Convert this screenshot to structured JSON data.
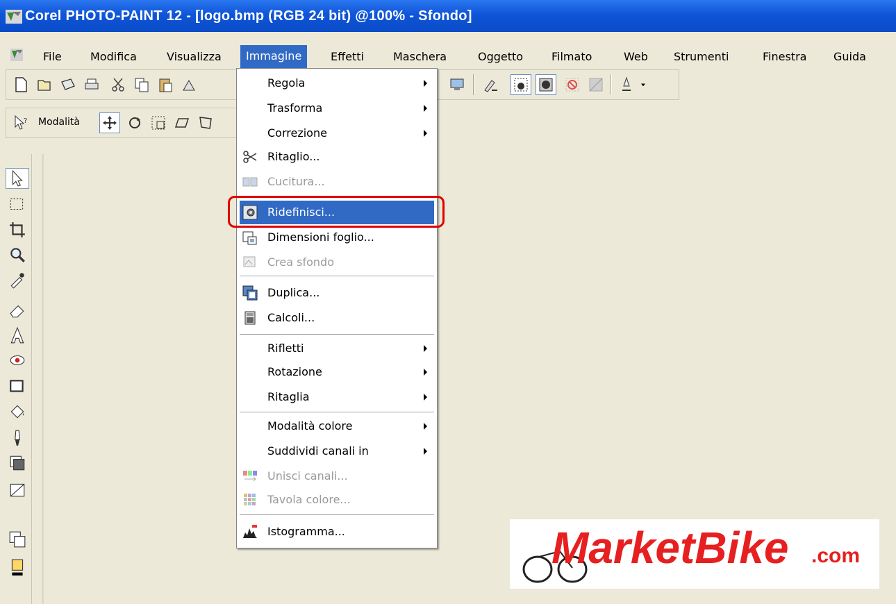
{
  "window": {
    "title": "Corel PHOTO-PAINT 12 - [logo.bmp (RGB 24 bit) @100% - Sfondo]"
  },
  "menubar": {
    "items": [
      {
        "label": "File"
      },
      {
        "label": "Modifica"
      },
      {
        "label": "Visualizza"
      },
      {
        "label": "Immagine",
        "active": true
      },
      {
        "label": "Effetti"
      },
      {
        "label": "Maschera"
      },
      {
        "label": "Oggetto"
      },
      {
        "label": "Filmato"
      },
      {
        "label": "Web"
      },
      {
        "label": "Strumenti"
      },
      {
        "label": "Finestra"
      },
      {
        "label": "Guida"
      }
    ]
  },
  "property_bar": {
    "mode_label": "Modalità"
  },
  "image_menu": {
    "items": [
      {
        "label": "Regola",
        "submenu": true
      },
      {
        "label": "Trasforma",
        "submenu": true
      },
      {
        "label": "Correzione",
        "submenu": true
      },
      {
        "label": "Ritaglio...",
        "icon": "crop-scissors-icon"
      },
      {
        "label": "Cucitura...",
        "icon": "stitch-icon",
        "disabled": true
      },
      {
        "label": "Ridefinisci...",
        "icon": "resample-icon",
        "highlighted": true
      },
      {
        "label": "Dimensioni foglio...",
        "icon": "paper-size-icon"
      },
      {
        "label": "Crea sfondo",
        "icon": "create-background-icon",
        "disabled": true
      },
      {
        "label": "Duplica...",
        "icon": "duplicate-icon"
      },
      {
        "label": "Calcoli...",
        "icon": "calculator-icon"
      },
      {
        "label": "Rifletti",
        "submenu": true
      },
      {
        "label": "Rotazione",
        "submenu": true
      },
      {
        "label": "Ritaglia",
        "submenu": true
      },
      {
        "label": "Modalità colore",
        "submenu": true
      },
      {
        "label": "Suddividi canali in",
        "submenu": true
      },
      {
        "label": "Unisci canali...",
        "icon": "combine-channels-icon",
        "disabled": true
      },
      {
        "label": "Tavola colore...",
        "icon": "color-table-icon",
        "disabled": true
      },
      {
        "label": "Istogramma...",
        "icon": "histogram-icon"
      }
    ]
  },
  "logo": {
    "brand": "MarketBike",
    "domain": ".com",
    "color": "#e62020"
  },
  "colors": {
    "titlebar": "#0a4bc7",
    "menu_highlight": "#316ac5",
    "annotation": "#e00000"
  }
}
